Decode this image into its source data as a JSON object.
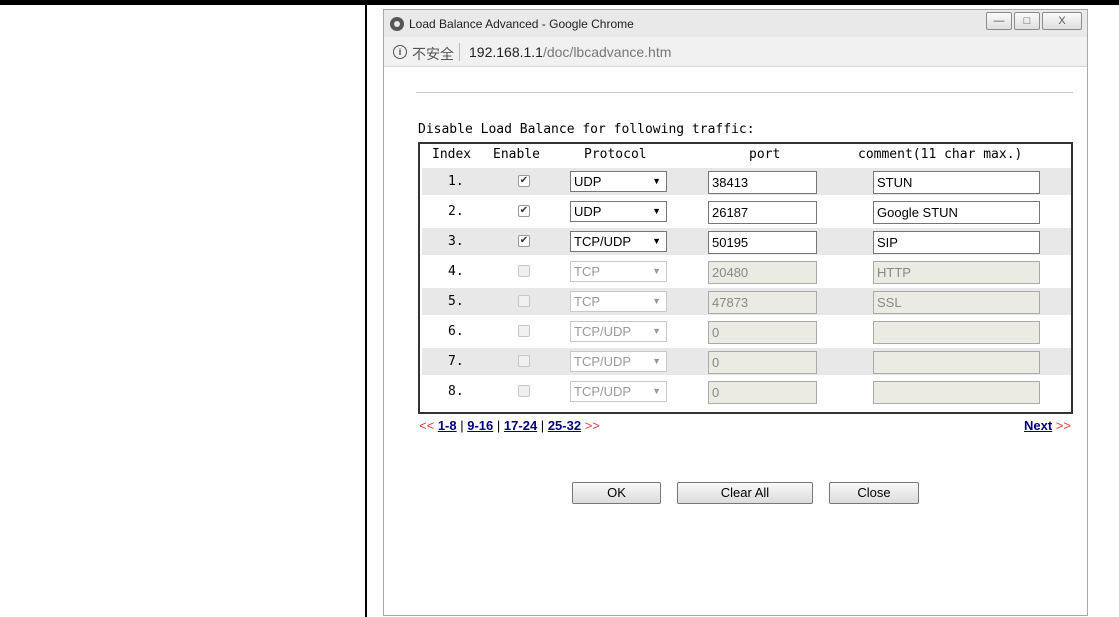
{
  "window": {
    "title": "Load Balance Advanced - Google Chrome",
    "insecure_label": "不安全",
    "url_host": "192.168.1.1",
    "url_path": "/doc/lbcadvance.htm",
    "info_glyph": "i",
    "controls": {
      "minimize": "—",
      "maximize": "□",
      "close": "X"
    }
  },
  "section_title": "Disable Load Balance for following traffic:",
  "table": {
    "headers": {
      "index": "Index",
      "enable": "Enable",
      "protocol": "Protocol",
      "port": "port",
      "comment": "comment(11 char max.)"
    },
    "rows": [
      {
        "index": "1.",
        "enabled": true,
        "protocol": "UDP",
        "port": "38413",
        "comment": "STUN"
      },
      {
        "index": "2.",
        "enabled": true,
        "protocol": "UDP",
        "port": "26187",
        "comment": "Google STUN"
      },
      {
        "index": "3.",
        "enabled": true,
        "protocol": "TCP/UDP",
        "port": "50195",
        "comment": "SIP"
      },
      {
        "index": "4.",
        "enabled": false,
        "protocol": "TCP",
        "port": "20480",
        "comment": "HTTP"
      },
      {
        "index": "5.",
        "enabled": false,
        "protocol": "TCP",
        "port": "47873",
        "comment": "SSL"
      },
      {
        "index": "6.",
        "enabled": false,
        "protocol": "TCP/UDP",
        "port": "0",
        "comment": ""
      },
      {
        "index": "7.",
        "enabled": false,
        "protocol": "TCP/UDP",
        "port": "0",
        "comment": ""
      },
      {
        "index": "8.",
        "enabled": false,
        "protocol": "TCP/UDP",
        "port": "0",
        "comment": ""
      }
    ],
    "check_glyph": "✔",
    "select_arrow": "▼"
  },
  "pager": {
    "prev_marker": "<<",
    "pages": [
      "1-8",
      "9-16",
      "17-24",
      "25-32"
    ],
    "sep": "|",
    "next_marker": ">>",
    "next_label": "Next"
  },
  "buttons": {
    "ok": "OK",
    "clear_all": "Clear All",
    "close": "Close"
  }
}
